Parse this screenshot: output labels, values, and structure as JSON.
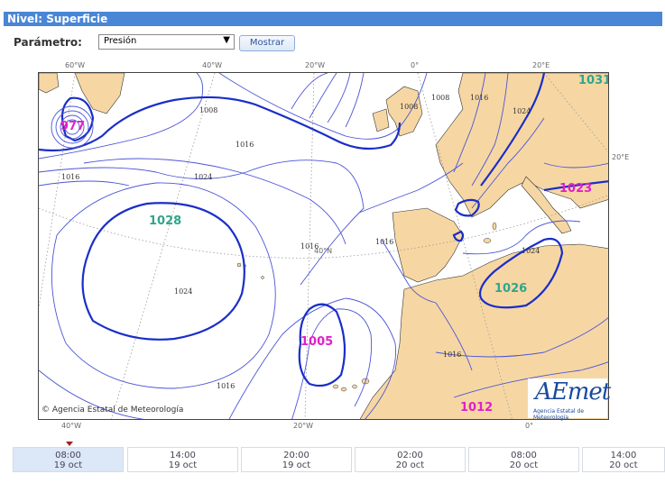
{
  "level_bar": {
    "label": "Nivel: Superficie"
  },
  "form": {
    "param_label": "Parámetro:",
    "param_value": "Presión",
    "show_button": "Mostrar"
  },
  "map": {
    "top_coords": [
      "60°W",
      "40°W",
      "20°W",
      "0°",
      "20°E"
    ],
    "bottom_coords": [
      "40°W",
      "20°W",
      "0°"
    ],
    "right_coord": "20°E",
    "lat_label": "40°N",
    "credit": "Agencia Estatal de Meteorología",
    "logo_text": "AEmet",
    "logo_sub": "Agencia Estatal de Meteorología",
    "centers": [
      {
        "value": "977",
        "kind": "low"
      },
      {
        "value": "1028",
        "kind": "high"
      },
      {
        "value": "1005",
        "kind": "low"
      },
      {
        "value": "1023",
        "kind": "low"
      },
      {
        "value": "1026",
        "kind": "high"
      },
      {
        "value": "1031",
        "kind": "high"
      },
      {
        "value": "1012",
        "kind": "low"
      }
    ],
    "isobar_labels": [
      "1008",
      "1016",
      "1016",
      "1024",
      "1024",
      "1016",
      "1016",
      "1016",
      "1008",
      "1008",
      "1016",
      "1024",
      "1024",
      "1016"
    ],
    "colors": {
      "high": "#2fa58c",
      "low": "#e020c8",
      "isobar": "#4b55d6",
      "land": "#f6d7a3",
      "sea": "#ffffff"
    }
  },
  "timeline": [
    {
      "time": "08:00",
      "date": "19 oct",
      "active": true
    },
    {
      "time": "14:00",
      "date": "19 oct",
      "active": false
    },
    {
      "time": "20:00",
      "date": "19 oct",
      "active": false
    },
    {
      "time": "02:00",
      "date": "20 oct",
      "active": false
    },
    {
      "time": "08:00",
      "date": "20 oct",
      "active": false
    },
    {
      "time": "14:00",
      "date": "20 oct",
      "active": false
    }
  ]
}
